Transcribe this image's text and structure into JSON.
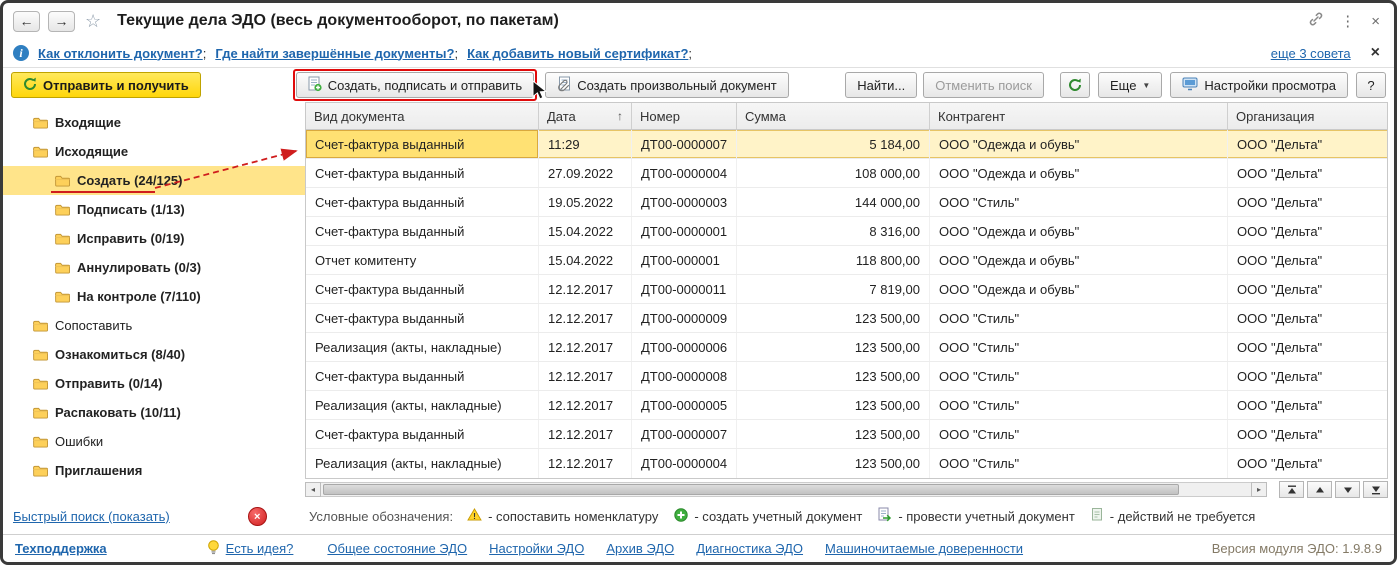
{
  "window": {
    "title": "Текущие дела ЭДО (весь документооборот, по пакетам)"
  },
  "icons": {
    "back": "←",
    "forward": "→",
    "favorite": "☆",
    "menu": "⋮",
    "close": "×",
    "info": "i",
    "dropdown_caret": "▼",
    "sort_asc": "↑",
    "scroll_left": "◂",
    "scroll_right": "▸",
    "help": "?"
  },
  "tips": {
    "links": [
      "Как отклонить документ?",
      "Где найти завершённые документы?",
      "Как добавить новый сертификат?"
    ],
    "separator": ";",
    "more": "еще 3 совета"
  },
  "toolbar": {
    "send_receive": "Отправить и получить",
    "create_sign_send": "Создать, подписать и отправить",
    "create_arbitrary": "Создать произвольный документ",
    "find": "Найти...",
    "cancel_search": "Отменить поиск",
    "more": "Еще",
    "view_settings": "Настройки просмотра",
    "help": "?"
  },
  "sidebar": {
    "items": [
      {
        "label": "Входящие",
        "level": 0,
        "bold": true,
        "selected": false
      },
      {
        "label": "Исходящие",
        "level": 0,
        "bold": true,
        "selected": false
      },
      {
        "label": "Создать (24/125)",
        "level": 1,
        "bold": true,
        "selected": true
      },
      {
        "label": "Подписать (1/13)",
        "level": 1,
        "bold": true,
        "selected": false
      },
      {
        "label": "Исправить (0/19)",
        "level": 1,
        "bold": true,
        "selected": false
      },
      {
        "label": "Аннулировать (0/3)",
        "level": 1,
        "bold": true,
        "selected": false
      },
      {
        "label": "На контроле (7/110)",
        "level": 1,
        "bold": true,
        "selected": false
      },
      {
        "label": "Сопоставить",
        "level": 0,
        "bold": false,
        "selected": false
      },
      {
        "label": "Ознакомиться (8/40)",
        "level": 0,
        "bold": true,
        "selected": false
      },
      {
        "label": "Отправить (0/14)",
        "level": 0,
        "bold": true,
        "selected": false
      },
      {
        "label": "Распаковать (10/11)",
        "level": 0,
        "bold": true,
        "selected": false
      },
      {
        "label": "Ошибки",
        "level": 0,
        "bold": false,
        "selected": false
      },
      {
        "label": "Приглашения",
        "level": 0,
        "bold": true,
        "selected": false
      }
    ],
    "quick_search": "Быстрый поиск (показать)"
  },
  "table": {
    "columns": [
      {
        "label": "Вид документа"
      },
      {
        "label": "Дата",
        "sort": "asc"
      },
      {
        "label": "Номер"
      },
      {
        "label": "Сумма",
        "align": "right"
      },
      {
        "label": "Контрагент"
      },
      {
        "label": "Организация"
      }
    ],
    "rows": [
      {
        "selected": true,
        "cells": [
          "Счет-фактура выданный",
          "11:29",
          "ДТ00-0000007",
          "5 184,00",
          "ООО \"Одежда и обувь\"",
          "ООО \"Дельта\""
        ]
      },
      {
        "selected": false,
        "cells": [
          "Счет-фактура выданный",
          "27.09.2022",
          "ДТ00-0000004",
          "108 000,00",
          "ООО \"Одежда и обувь\"",
          "ООО \"Дельта\""
        ]
      },
      {
        "selected": false,
        "cells": [
          "Счет-фактура выданный",
          "19.05.2022",
          "ДТ00-0000003",
          "144 000,00",
          "ООО \"Стиль\"",
          "ООО \"Дельта\""
        ]
      },
      {
        "selected": false,
        "cells": [
          "Счет-фактура выданный",
          "15.04.2022",
          "ДТ00-0000001",
          "8 316,00",
          "ООО \"Одежда и обувь\"",
          "ООО \"Дельта\""
        ]
      },
      {
        "selected": false,
        "cells": [
          "Отчет комитенту",
          "15.04.2022",
          "ДТ00-000001",
          "118 800,00",
          "ООО \"Одежда и обувь\"",
          "ООО \"Дельта\""
        ]
      },
      {
        "selected": false,
        "cells": [
          "Счет-фактура выданный",
          "12.12.2017",
          "ДТ00-0000011",
          "7 819,00",
          "ООО \"Одежда и обувь\"",
          "ООО \"Дельта\""
        ]
      },
      {
        "selected": false,
        "cells": [
          "Счет-фактура выданный",
          "12.12.2017",
          "ДТ00-0000009",
          "123 500,00",
          "ООО \"Стиль\"",
          "ООО \"Дельта\""
        ]
      },
      {
        "selected": false,
        "cells": [
          "Реализация (акты, накладные)",
          "12.12.2017",
          "ДТ00-0000006",
          "123 500,00",
          "ООО \"Стиль\"",
          "ООО \"Дельта\""
        ]
      },
      {
        "selected": false,
        "cells": [
          "Счет-фактура выданный",
          "12.12.2017",
          "ДТ00-0000008",
          "123 500,00",
          "ООО \"Стиль\"",
          "ООО \"Дельта\""
        ]
      },
      {
        "selected": false,
        "cells": [
          "Реализация (акты, накладные)",
          "12.12.2017",
          "ДТ00-0000005",
          "123 500,00",
          "ООО \"Стиль\"",
          "ООО \"Дельта\""
        ]
      },
      {
        "selected": false,
        "cells": [
          "Счет-фактура выданный",
          "12.12.2017",
          "ДТ00-0000007",
          "123 500,00",
          "ООО \"Стиль\"",
          "ООО \"Дельта\""
        ]
      },
      {
        "selected": false,
        "cells": [
          "Реализация (акты, накладные)",
          "12.12.2017",
          "ДТ00-0000004",
          "123 500,00",
          "ООО \"Стиль\"",
          "ООО \"Дельта\""
        ]
      }
    ]
  },
  "legend": {
    "label": "Условные обозначения:",
    "items": [
      {
        "icon": "warning-triangle-icon",
        "text": "-  сопоставить номенклатуру"
      },
      {
        "icon": "green-plus-icon",
        "text": "-  создать учетный документ"
      },
      {
        "icon": "post-document-icon",
        "text": "-  провести учетный документ"
      },
      {
        "icon": "no-action-icon",
        "text": "-  действий не требуется"
      }
    ]
  },
  "footer": {
    "support": "Техподдержка",
    "idea": "Есть идея?",
    "links": [
      "Общее состояние ЭДО",
      "Настройки ЭДО",
      "Архив ЭДО",
      "Диагностика ЭДО",
      "Машиночитаемые доверенности"
    ],
    "version": "Версия модуля ЭДО: 1.9.8.9"
  }
}
